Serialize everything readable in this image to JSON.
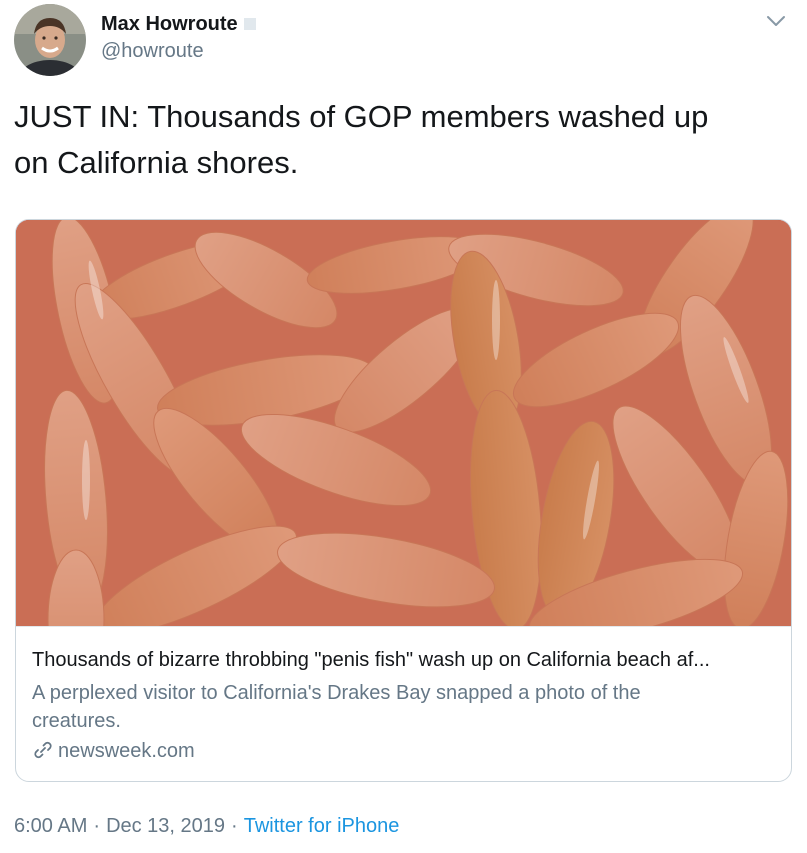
{
  "author": {
    "display_name": "Max Howroute",
    "handle": "@howroute",
    "avatar_icon": "profile-photo"
  },
  "menu": {
    "icon": "chevron-down-icon"
  },
  "tweet": {
    "text_line1": "JUST IN: Thousands of GOP members washed up",
    "text_line2": "on California shores."
  },
  "card": {
    "image_description_icon": "fish-photo",
    "title": "Thousands of bizarre throbbing \"penis fish\" wash up on California beach af...",
    "description": "A perplexed visitor to California's Drakes Bay snapped a photo of the creatures.",
    "domain": "newsweek.com",
    "link_icon": "link-icon"
  },
  "meta": {
    "time": "6:00 AM",
    "date": "Dec 13, 2019",
    "separator": "·",
    "source": "Twitter for iPhone"
  },
  "colors": {
    "text": "#14171a",
    "secondary": "#657786",
    "link": "#1b95e0",
    "border": "#ccd6dd"
  }
}
